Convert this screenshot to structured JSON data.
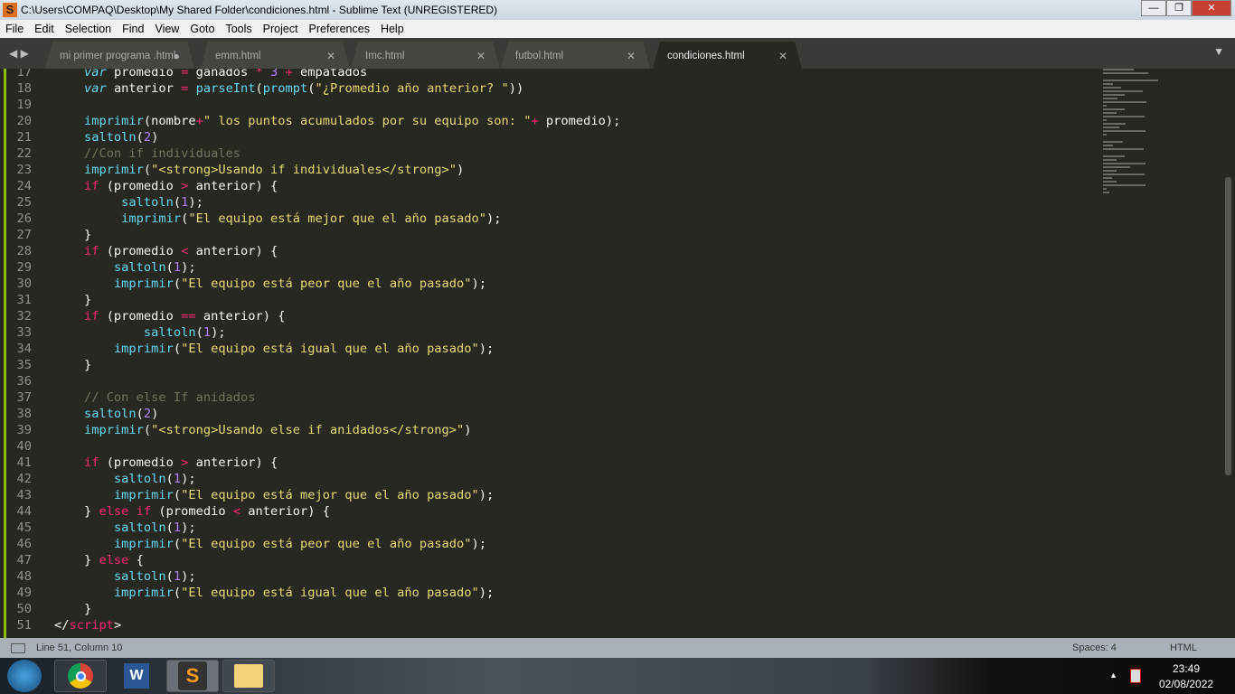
{
  "window": {
    "title": "C:\\Users\\COMPAQ\\Desktop\\My Shared Folder\\condiciones.html - Sublime Text (UNREGISTERED)",
    "minimize": "—",
    "maximize": "❐",
    "close": "✕"
  },
  "menu": [
    "File",
    "Edit",
    "Selection",
    "Find",
    "View",
    "Goto",
    "Tools",
    "Project",
    "Preferences",
    "Help"
  ],
  "tabs": [
    {
      "label": "mi primer programa .html",
      "mark": "●"
    },
    {
      "label": "emm.html",
      "mark": "✕"
    },
    {
      "label": "Imc.html",
      "mark": "✕"
    },
    {
      "label": "futbol.html",
      "mark": "✕"
    },
    {
      "label": "condiciones.html",
      "mark": "✕",
      "active": true
    }
  ],
  "tab_nav": "◀ ▶",
  "tab_overflow": "▼",
  "colors": {
    "background": "#272822",
    "keyword": "#f92672",
    "function": "#66d9ef",
    "string": "#e6db74",
    "number": "#ae81ff",
    "comment": "#75715e"
  },
  "code": [
    {
      "n": "17",
      "t": [
        [
          "t",
          "    "
        ],
        [
          "v",
          "var"
        ],
        [
          "t",
          " promedio "
        ],
        [
          "k",
          "="
        ],
        [
          "t",
          " ganados "
        ],
        [
          "k",
          "*"
        ],
        [
          "t",
          " "
        ],
        [
          "n",
          "3"
        ],
        [
          "t",
          " "
        ],
        [
          "k",
          "+"
        ],
        [
          "t",
          " empatados"
        ]
      ]
    },
    {
      "n": "18",
      "t": [
        [
          "t",
          "    "
        ],
        [
          "v",
          "var"
        ],
        [
          "t",
          " anterior "
        ],
        [
          "k",
          "="
        ],
        [
          "t",
          " "
        ],
        [
          "f",
          "parseInt"
        ],
        [
          "t",
          "("
        ],
        [
          "f",
          "prompt"
        ],
        [
          "t",
          "("
        ],
        [
          "s",
          "\"¿Promedio año anterior? \""
        ],
        [
          "t",
          "))"
        ]
      ]
    },
    {
      "n": "19",
      "t": []
    },
    {
      "n": "20",
      "t": [
        [
          "t",
          "    "
        ],
        [
          "f",
          "imprimir"
        ],
        [
          "t",
          "(nombre"
        ],
        [
          "k",
          "+"
        ],
        [
          "s",
          "\" los puntos acumulados por su equipo son: \""
        ],
        [
          "k",
          "+"
        ],
        [
          "t",
          " promedio);"
        ]
      ]
    },
    {
      "n": "21",
      "t": [
        [
          "t",
          "    "
        ],
        [
          "f",
          "saltoln"
        ],
        [
          "t",
          "("
        ],
        [
          "n",
          "2"
        ],
        [
          "t",
          ")"
        ]
      ]
    },
    {
      "n": "22",
      "t": [
        [
          "t",
          "    "
        ],
        [
          "c",
          "//Con if individuales"
        ]
      ]
    },
    {
      "n": "23",
      "t": [
        [
          "t",
          "    "
        ],
        [
          "f",
          "imprimir"
        ],
        [
          "t",
          "("
        ],
        [
          "s",
          "\"<strong>Usando if individuales</strong>\""
        ],
        [
          "t",
          ")"
        ]
      ]
    },
    {
      "n": "24",
      "t": [
        [
          "t",
          "    "
        ],
        [
          "k",
          "if"
        ],
        [
          "t",
          " (promedio "
        ],
        [
          "k",
          ">"
        ],
        [
          "t",
          " anterior) {"
        ]
      ]
    },
    {
      "n": "25",
      "t": [
        [
          "t",
          "         "
        ],
        [
          "f",
          "saltoln"
        ],
        [
          "t",
          "("
        ],
        [
          "n",
          "1"
        ],
        [
          "t",
          ");"
        ]
      ]
    },
    {
      "n": "26",
      "t": [
        [
          "t",
          "         "
        ],
        [
          "f",
          "imprimir"
        ],
        [
          "t",
          "("
        ],
        [
          "s",
          "\"El equipo está mejor que el año pasado\""
        ],
        [
          "t",
          ");"
        ]
      ]
    },
    {
      "n": "27",
      "t": [
        [
          "t",
          "    }"
        ]
      ]
    },
    {
      "n": "28",
      "t": [
        [
          "t",
          "    "
        ],
        [
          "k",
          "if"
        ],
        [
          "t",
          " (promedio "
        ],
        [
          "k",
          "<"
        ],
        [
          "t",
          " anterior) {"
        ]
      ]
    },
    {
      "n": "29",
      "t": [
        [
          "t",
          "        "
        ],
        [
          "f",
          "saltoln"
        ],
        [
          "t",
          "("
        ],
        [
          "n",
          "1"
        ],
        [
          "t",
          ");"
        ]
      ]
    },
    {
      "n": "30",
      "t": [
        [
          "t",
          "        "
        ],
        [
          "f",
          "imprimir"
        ],
        [
          "t",
          "("
        ],
        [
          "s",
          "\"El equipo está peor que el año pasado\""
        ],
        [
          "t",
          ");"
        ]
      ]
    },
    {
      "n": "31",
      "t": [
        [
          "t",
          "    }"
        ]
      ]
    },
    {
      "n": "32",
      "t": [
        [
          "t",
          "    "
        ],
        [
          "k",
          "if"
        ],
        [
          "t",
          " (promedio "
        ],
        [
          "k",
          "=="
        ],
        [
          "t",
          " anterior) {"
        ]
      ]
    },
    {
      "n": "33",
      "t": [
        [
          "t",
          "            "
        ],
        [
          "f",
          "saltoln"
        ],
        [
          "t",
          "("
        ],
        [
          "n",
          "1"
        ],
        [
          "t",
          ");"
        ]
      ]
    },
    {
      "n": "34",
      "t": [
        [
          "t",
          "        "
        ],
        [
          "f",
          "imprimir"
        ],
        [
          "t",
          "("
        ],
        [
          "s",
          "\"El equipo está igual que el año pasado\""
        ],
        [
          "t",
          ");"
        ]
      ]
    },
    {
      "n": "35",
      "t": [
        [
          "t",
          "    }"
        ]
      ]
    },
    {
      "n": "36",
      "t": []
    },
    {
      "n": "37",
      "t": [
        [
          "t",
          "    "
        ],
        [
          "c",
          "// Con else If anidados"
        ]
      ]
    },
    {
      "n": "38",
      "t": [
        [
          "t",
          "    "
        ],
        [
          "f",
          "saltoln"
        ],
        [
          "t",
          "("
        ],
        [
          "n",
          "2"
        ],
        [
          "t",
          ")"
        ]
      ]
    },
    {
      "n": "39",
      "t": [
        [
          "t",
          "    "
        ],
        [
          "f",
          "imprimir"
        ],
        [
          "t",
          "("
        ],
        [
          "s",
          "\"<strong>Usando else if anidados</strong>\""
        ],
        [
          "t",
          ")"
        ]
      ]
    },
    {
      "n": "40",
      "t": []
    },
    {
      "n": "41",
      "t": [
        [
          "t",
          "    "
        ],
        [
          "k",
          "if"
        ],
        [
          "t",
          " (promedio "
        ],
        [
          "k",
          ">"
        ],
        [
          "t",
          " anterior) {"
        ]
      ]
    },
    {
      "n": "42",
      "t": [
        [
          "t",
          "        "
        ],
        [
          "f",
          "saltoln"
        ],
        [
          "t",
          "("
        ],
        [
          "n",
          "1"
        ],
        [
          "t",
          ");"
        ]
      ]
    },
    {
      "n": "43",
      "t": [
        [
          "t",
          "        "
        ],
        [
          "f",
          "imprimir"
        ],
        [
          "t",
          "("
        ],
        [
          "s",
          "\"El equipo está mejor que el año pasado\""
        ],
        [
          "t",
          ");"
        ]
      ]
    },
    {
      "n": "44",
      "t": [
        [
          "t",
          "    } "
        ],
        [
          "k",
          "else"
        ],
        [
          "t",
          " "
        ],
        [
          "k",
          "if"
        ],
        [
          "t",
          " (promedio "
        ],
        [
          "k",
          "<"
        ],
        [
          "t",
          " anterior) {"
        ]
      ]
    },
    {
      "n": "45",
      "t": [
        [
          "t",
          "        "
        ],
        [
          "f",
          "saltoln"
        ],
        [
          "t",
          "("
        ],
        [
          "n",
          "1"
        ],
        [
          "t",
          ");"
        ]
      ]
    },
    {
      "n": "46",
      "t": [
        [
          "t",
          "        "
        ],
        [
          "f",
          "imprimir"
        ],
        [
          "t",
          "("
        ],
        [
          "s",
          "\"El equipo está peor que el año pasado\""
        ],
        [
          "t",
          ");"
        ]
      ]
    },
    {
      "n": "47",
      "t": [
        [
          "t",
          "    } "
        ],
        [
          "k",
          "else"
        ],
        [
          "t",
          " {"
        ]
      ]
    },
    {
      "n": "48",
      "t": [
        [
          "t",
          "        "
        ],
        [
          "f",
          "saltoln"
        ],
        [
          "t",
          "("
        ],
        [
          "n",
          "1"
        ],
        [
          "t",
          ");"
        ]
      ]
    },
    {
      "n": "49",
      "t": [
        [
          "t",
          "        "
        ],
        [
          "f",
          "imprimir"
        ],
        [
          "t",
          "("
        ],
        [
          "s",
          "\"El equipo está igual que el año pasado\""
        ],
        [
          "t",
          ");"
        ]
      ]
    },
    {
      "n": "50",
      "t": [
        [
          "t",
          "    }"
        ]
      ]
    },
    {
      "n": "51",
      "t": [
        [
          "t",
          "</"
        ],
        [
          "k",
          "script"
        ],
        [
          "t",
          ">"
        ]
      ]
    }
  ],
  "status": {
    "position": "Line 51, Column 10",
    "spaces": "Spaces: 4",
    "syntax": "HTML"
  },
  "taskbar": {
    "time": "23:49",
    "date": "02/08/2022",
    "apps": [
      "start-icon",
      "chrome-icon",
      "word-icon",
      "sublime-icon",
      "explorer-icon"
    ]
  }
}
